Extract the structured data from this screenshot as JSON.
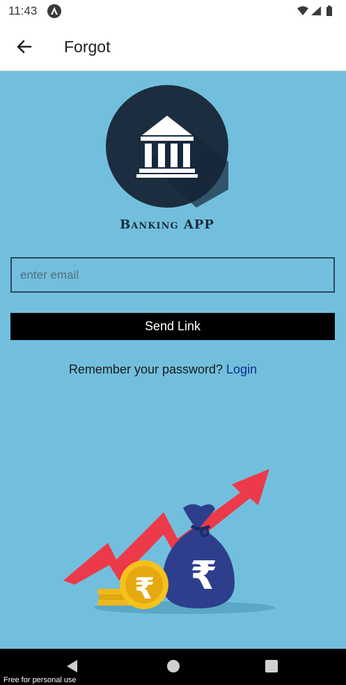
{
  "status_bar": {
    "time": "11:43",
    "icons": [
      "notification-icon",
      "wifi-icon",
      "signal-icon",
      "battery-icon"
    ]
  },
  "app_bar": {
    "title": "Forgot",
    "back_icon": "arrow-left-icon"
  },
  "logo": {
    "icon": "bank-building-icon",
    "brand_name": "Banking APP"
  },
  "form": {
    "email_placeholder": "enter email",
    "email_value": "",
    "send_label": "Send Link"
  },
  "footer_text": {
    "prompt": "Remember your password?",
    "login_label": "Login"
  },
  "illustration": {
    "icon": "rupee-money-bag-growth-illustration"
  },
  "nav_bar": {
    "buttons": [
      "back-triangle-icon",
      "home-circle-icon",
      "recents-square-icon"
    ]
  },
  "watermark": "Free for personal use",
  "colors": {
    "background": "#72bfdd",
    "button": "#000000",
    "link": "#0d2e8c",
    "logo_circle": "#1b2d3e"
  }
}
